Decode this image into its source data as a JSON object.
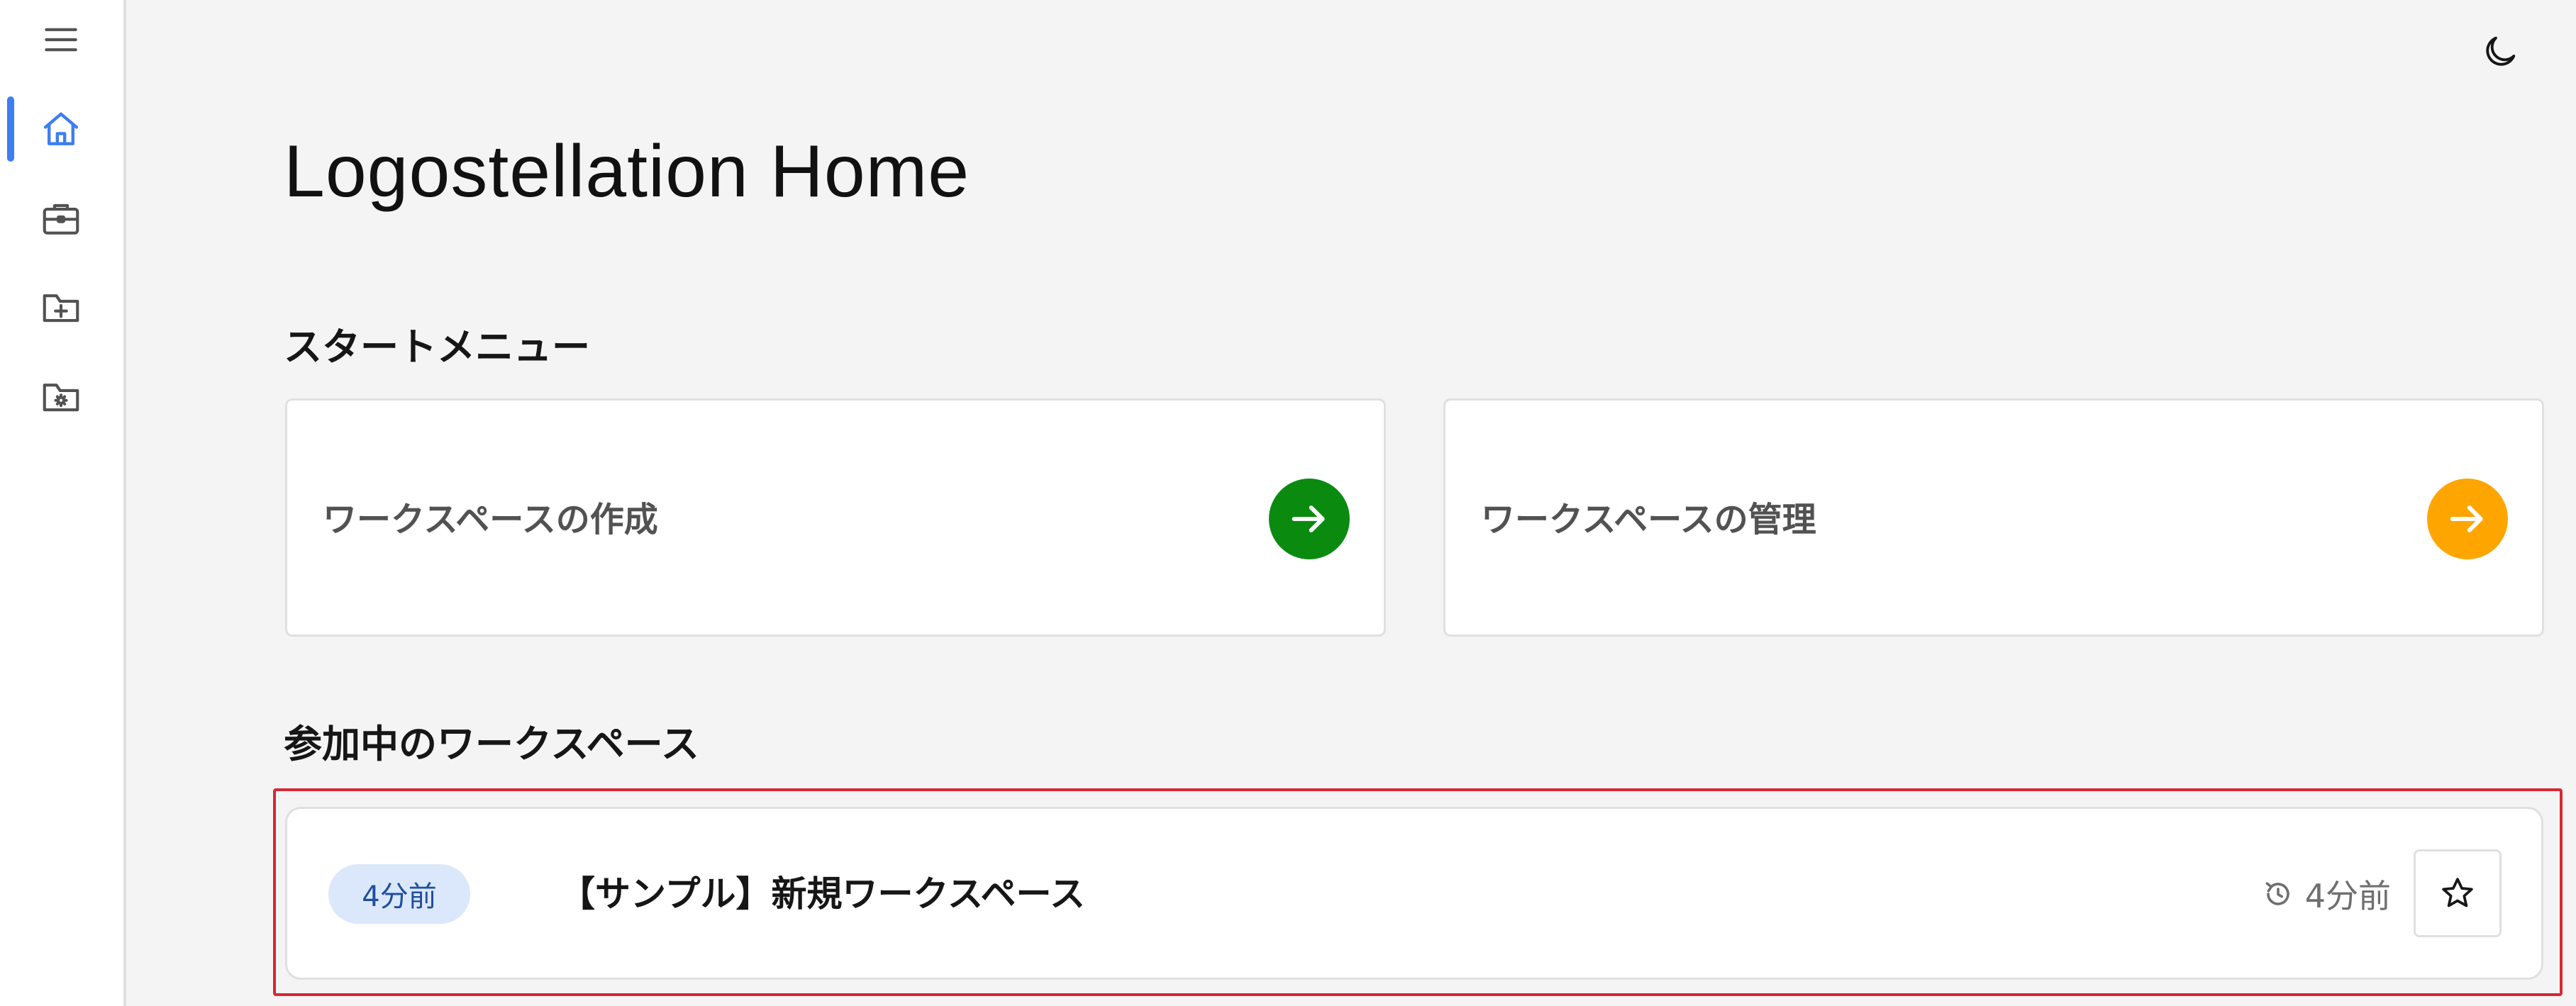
{
  "page": {
    "title": "Logostellation Home"
  },
  "sidebar": {
    "items": [
      {
        "icon": "menu-icon",
        "active": false
      },
      {
        "icon": "home-icon",
        "active": true
      },
      {
        "icon": "briefcase-icon",
        "active": false
      },
      {
        "icon": "folder-plus-icon",
        "active": false
      },
      {
        "icon": "folder-settings-icon",
        "active": false
      }
    ],
    "accent_color": "#3d7ef0"
  },
  "header": {
    "theme_toggle_icon": "moon-icon"
  },
  "start_menu": {
    "title": "スタートメニュー",
    "cards": [
      {
        "label": "ワークスペースの作成",
        "icon": "arrow-right-icon",
        "color": "#0b8a10"
      },
      {
        "label": "ワークスペースの管理",
        "icon": "arrow-right-icon",
        "color": "#ffa500"
      }
    ]
  },
  "joined": {
    "title": "参加中のワークスペース",
    "workspaces": [
      {
        "badge": "4分前",
        "name": "【サンプル】新規ワークスペース",
        "updated": "4分前",
        "history_icon": "history-icon",
        "star_icon": "star-icon"
      }
    ]
  }
}
